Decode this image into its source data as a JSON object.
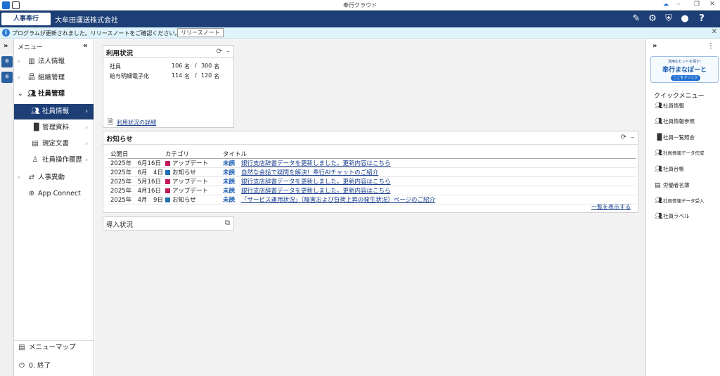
{
  "window": {
    "title": "奉行クラウド"
  },
  "header": {
    "logo_text": "人事奉行",
    "company": "大牟田運送株式会社"
  },
  "notice": {
    "message": "プログラムが更新されました。リリースノートをご確認ください。",
    "button": "リリースノート"
  },
  "sidebar": {
    "header": "メニュー",
    "items": [
      {
        "label": "法人情報"
      },
      {
        "label": "組織管理"
      },
      {
        "label": "社員管理"
      },
      {
        "label": "社員情報"
      },
      {
        "label": "管理資料"
      },
      {
        "label": "規定文書"
      },
      {
        "label": "社員操作履歴"
      },
      {
        "label": "人事異動"
      },
      {
        "label": "App Connect"
      }
    ],
    "menu_map": "メニューマップ",
    "exit": "0. 終了"
  },
  "usage": {
    "title": "利用状況",
    "rows": [
      {
        "label": "社員",
        "used": "106",
        "unit1": "名",
        "sep": "/",
        "total": "300",
        "unit2": "名"
      },
      {
        "label": "給与明細電子化",
        "used": "114",
        "unit1": "名",
        "sep": "/",
        "total": "120",
        "unit2": "名"
      }
    ],
    "detail_link": "利用状況の詳細"
  },
  "news": {
    "title": "お知らせ",
    "headers": {
      "date": "公開日",
      "category": "カテゴリ",
      "title": "タイトル"
    },
    "rows": [
      {
        "date": "2025年　6月16日",
        "category": "アップデート",
        "status": "未読",
        "title": "銀行支店辞書データを更新しました。更新内容はこちら"
      },
      {
        "date": "2025年　6月　4日",
        "category": "お知らせ",
        "status": "未読",
        "title": "自然な会話で疑問を解決！奉行AIチャットのご紹介"
      },
      {
        "date": "2025年　5月16日",
        "category": "アップデート",
        "status": "未読",
        "title": "銀行支店辞書データを更新しました。更新内容はこちら"
      },
      {
        "date": "2025年　4月16日",
        "category": "アップデート",
        "status": "未読",
        "title": "銀行支店辞書データを更新しました。更新内容はこちら"
      },
      {
        "date": "2025年　4月　9日",
        "category": "お知らせ",
        "status": "未読",
        "title": "「サービス運用状況」（障害および負荷上昇の発生状況）ページのご紹介"
      }
    ],
    "show_all": "一覧を表示する"
  },
  "intro": {
    "title": "導入状況"
  },
  "right": {
    "banner_top": "活用のヒントを探す!",
    "banner_main": "奉行まなぽーと",
    "banner_btn": "ここをクリック",
    "quick_title": "クイックメニュー",
    "items": [
      {
        "label": "社員情報",
        "icon": "people-icon"
      },
      {
        "label": "社員情報参照",
        "icon": "people-icon"
      },
      {
        "label": "社員一覧照会",
        "icon": "books-icon"
      },
      {
        "label": "社員情報データ作成",
        "icon": "people-icon"
      },
      {
        "label": "社員台帳",
        "icon": "people-icon"
      },
      {
        "label": "労働者名簿",
        "icon": "register-icon"
      },
      {
        "label": "社員情報データ受入",
        "icon": "people-icon"
      },
      {
        "label": "社員ラベル",
        "icon": "people-icon"
      }
    ]
  },
  "colors": {
    "header_bg": "#1d3f76",
    "update": "#c2185b",
    "info": "#1f6fb2",
    "unread": "#1a5fb4"
  }
}
